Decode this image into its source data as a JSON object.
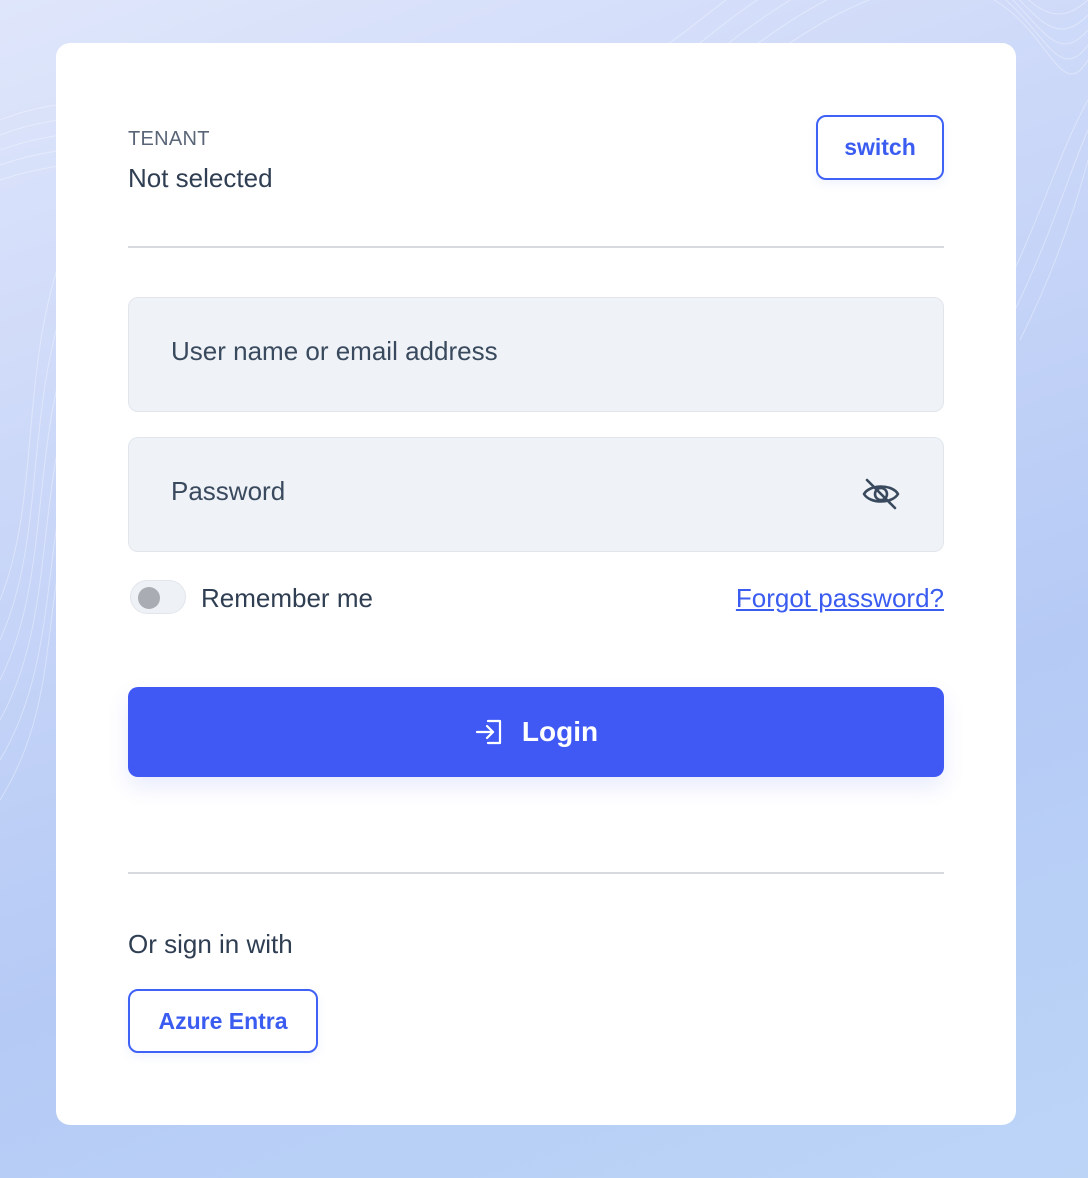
{
  "tenant": {
    "label": "TENANT",
    "value": "Not selected",
    "switch_label": "switch"
  },
  "form": {
    "username_placeholder": "User name or email address",
    "password_placeholder": "Password",
    "remember_label": "Remember me",
    "remember_checked": false,
    "forgot_label": "Forgot password?",
    "login_label": "Login"
  },
  "alt_sign_in": {
    "heading": "Or sign in with",
    "providers": [
      "Azure Entra"
    ]
  },
  "icons": {
    "password_toggle": "eye-slash-icon",
    "login": "login-arrow-icon"
  },
  "colors": {
    "accent": "#4059f4",
    "link": "#3b5cf0",
    "text": "#2f3e52",
    "input_bg": "#eff2f6"
  }
}
